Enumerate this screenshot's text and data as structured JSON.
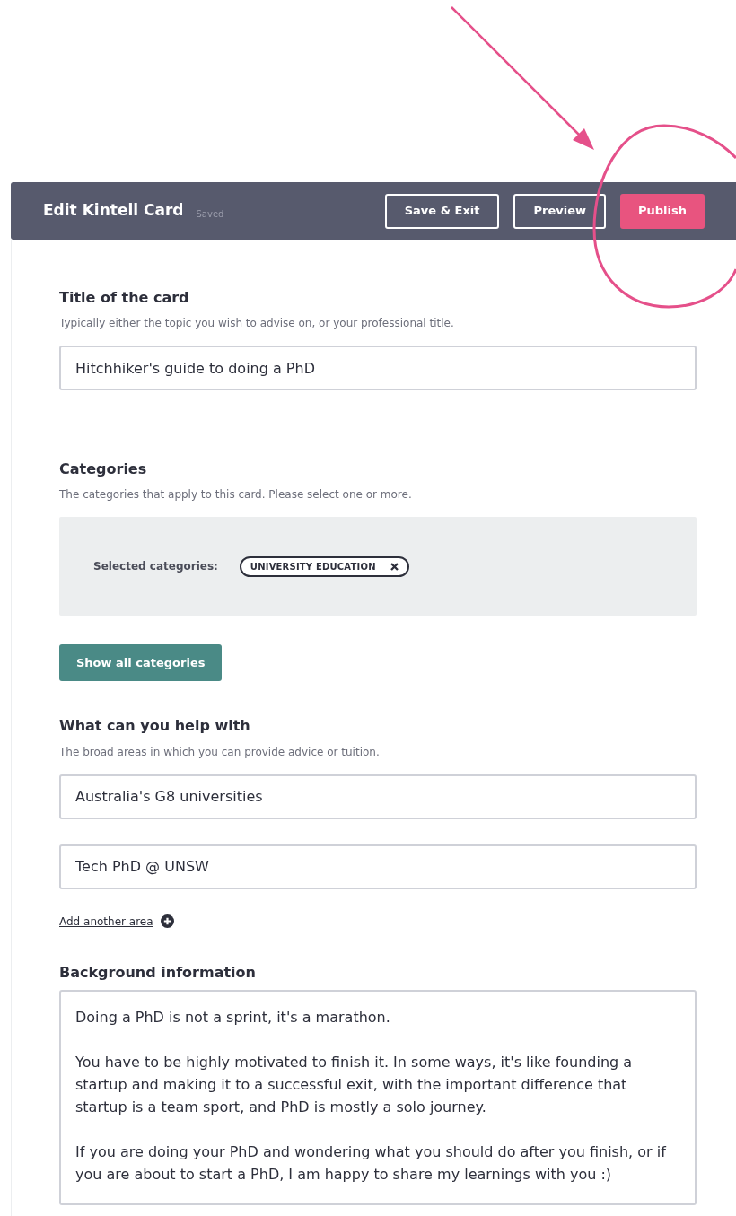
{
  "header": {
    "title": "Edit Kintell Card",
    "status": "Saved",
    "buttons": [
      {
        "label": "Save & Exit",
        "kind": "outline"
      },
      {
        "label": "Preview",
        "kind": "outline"
      },
      {
        "label": "Publish",
        "kind": "primary"
      }
    ]
  },
  "title_section": {
    "heading": "Title of the card",
    "hint": "Typically either the topic you wish to advise on, or your professional title.",
    "value": "Hitchhiker's guide to doing a PhD"
  },
  "categories": {
    "heading": "Categories",
    "hint": "The categories that apply to this card. Please select one or more.",
    "selected_label": "Selected categories:",
    "tags": [
      "UNIVERSITY EDUCATION"
    ],
    "button": "Show all categories"
  },
  "help_section": {
    "heading": "What can you help with",
    "hint": "The broad areas in which you can provide advice or tuition.",
    "areas": [
      "Australia's G8 universities",
      "Tech PhD @ UNSW"
    ],
    "add_link": "Add another area"
  },
  "background": {
    "heading": "Background information",
    "paragraphs": [
      "Doing a PhD is not a sprint, it's a marathon.",
      "You have to be highly motivated to finish it. In some ways, it's like founding a startup and making it to a successful exit, with the important difference that startup is a team sport, and PhD is mostly a solo journey.",
      "If you are doing your PhD and wondering what you should do after you finish, or if you are about to start a PhD, I am happy to share my learnings with you :)"
    ]
  }
}
